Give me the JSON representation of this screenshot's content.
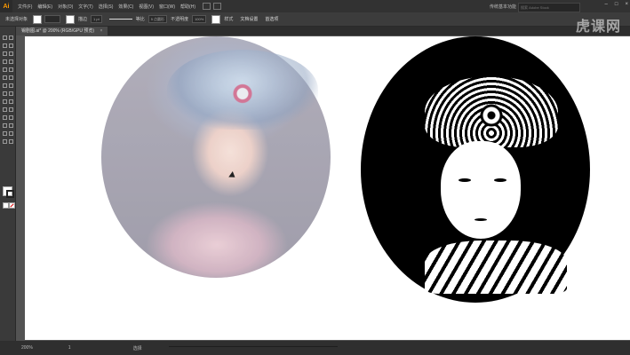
{
  "app": {
    "logo": "Ai"
  },
  "menu": [
    "文件(F)",
    "编辑(E)",
    "对象(O)",
    "文字(T)",
    "选择(S)",
    "效果(C)",
    "视图(V)",
    "窗口(W)",
    "帮助(H)"
  ],
  "workspace": "传统基本功能",
  "search_placeholder": "搜索 Adobe Stock",
  "control_bar": {
    "selection_label": "未选择对象",
    "stroke_label": "描边",
    "stroke_weight": "1 pt",
    "brush_label": "等比",
    "profile_label": "5 点圆形",
    "opacity_label": "不透明度",
    "opacity_value": "100%",
    "style_label": "样式",
    "doc_setup": "文档设置",
    "preferences": "首选项"
  },
  "tab": {
    "title": "锡剧图.ai* @ 200% (RGB/GPU 预览)",
    "close": "×"
  },
  "status": {
    "zoom": "200%",
    "page": "1",
    "text": "选择"
  },
  "watermark": "虎课网",
  "colors": {
    "accent": "#ff9a00",
    "canvas": "#ffffff",
    "chrome": "#535353"
  }
}
